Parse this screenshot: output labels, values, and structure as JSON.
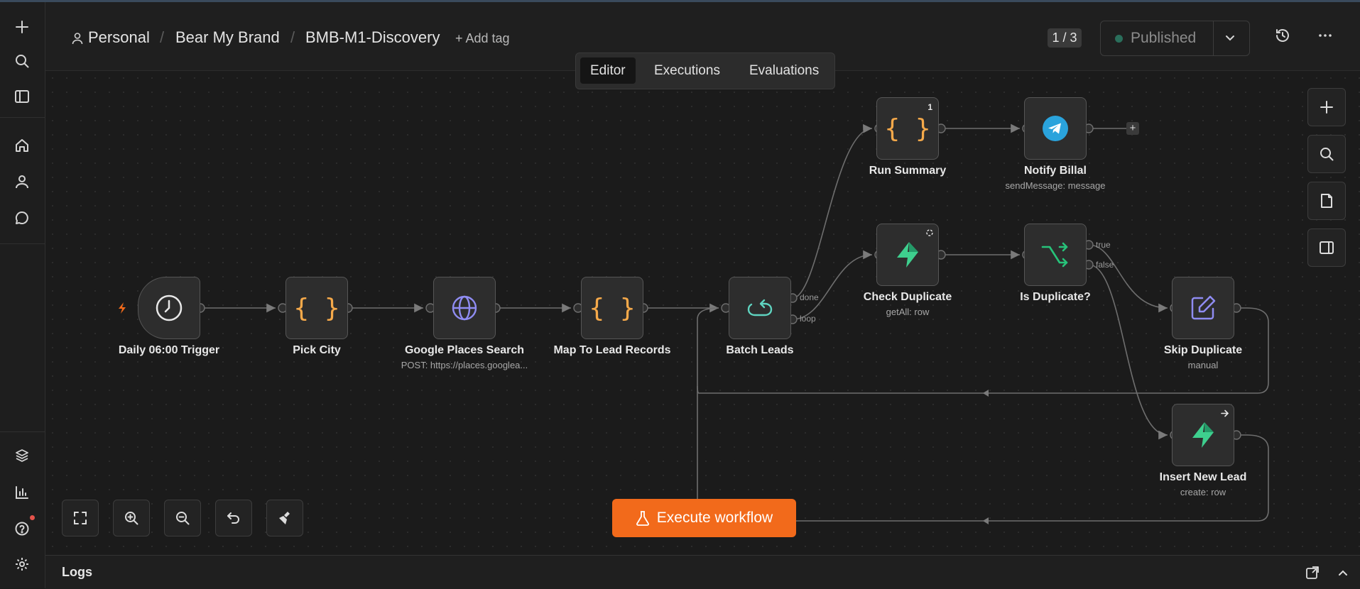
{
  "breadcrumb": {
    "personal": "Personal",
    "project": "Bear My Brand",
    "workflow": "BMB-M1-Discovery",
    "add_tag": "+ Add tag"
  },
  "header": {
    "counter": "1 / 3",
    "publish_status": "Published"
  },
  "tabs": [
    {
      "label": "Editor",
      "active": true
    },
    {
      "label": "Executions"
    },
    {
      "label": "Evaluations"
    }
  ],
  "nodes": {
    "trigger": {
      "label": "Daily 06:00 Trigger"
    },
    "pick_city": {
      "label": "Pick City"
    },
    "google_places": {
      "label": "Google Places Search",
      "sub": "POST: https://places.googlea..."
    },
    "map_leads": {
      "label": "Map To Lead Records"
    },
    "batch": {
      "label": "Batch Leads",
      "ports": {
        "done": "done",
        "loop": "loop"
      }
    },
    "run_summary": {
      "label": "Run Summary",
      "badge": "1"
    },
    "notify": {
      "label": "Notify Billal",
      "sub": "sendMessage: message"
    },
    "check_dup": {
      "label": "Check Duplicate",
      "sub": "getAll: row"
    },
    "is_dup": {
      "label": "Is Duplicate?",
      "ports": {
        "true": "true",
        "false": "false"
      }
    },
    "skip_dup": {
      "label": "Skip Duplicate",
      "sub": "manual"
    },
    "insert_lead": {
      "label": "Insert New Lead",
      "sub": "create: row"
    }
  },
  "execute_button": "Execute workflow",
  "logs": {
    "title": "Logs"
  },
  "colors": {
    "accent": "#f26a1b",
    "code": "#f5a94a",
    "globe": "#8f8cf2",
    "supabase": "#3ecf8e",
    "telegram": "#2aa3dc",
    "published_dot": "#2a6e5b"
  }
}
